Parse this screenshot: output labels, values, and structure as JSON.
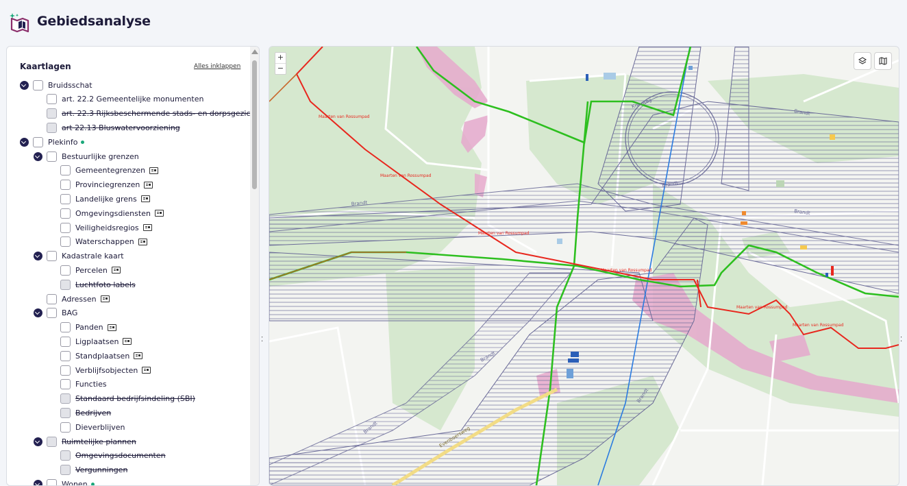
{
  "app": {
    "title": "Gebiedsanalyse"
  },
  "panel": {
    "title": "Kaartlagen",
    "collapse_all": "Alles inklappen",
    "rows": [
      {
        "label": "Bruidsschat",
        "level": 0,
        "toggle": true,
        "disabled": false,
        "strike": false,
        "info": false,
        "dot": false
      },
      {
        "label": "art. 22.2 Gemeentelijke monumenten",
        "level": 1,
        "toggle": false,
        "disabled": false,
        "strike": false,
        "info": false,
        "dot": false
      },
      {
        "label": "art. 22.3 Rijksbeschermende stads- en dorpsgezichten",
        "level": 1,
        "toggle": false,
        "disabled": true,
        "strike": true,
        "info": false,
        "dot": false
      },
      {
        "label": "art 22.13 Bluswatervoorziening",
        "level": 1,
        "toggle": false,
        "disabled": true,
        "strike": true,
        "info": false,
        "dot": false
      },
      {
        "label": "Plekinfo",
        "level": 0,
        "toggle": true,
        "disabled": false,
        "strike": false,
        "info": false,
        "dot": true
      },
      {
        "label": "Bestuurlijke grenzen",
        "level": 1,
        "toggle": true,
        "disabled": false,
        "strike": false,
        "info": false,
        "dot": false
      },
      {
        "label": "Gemeentegrenzen",
        "level": 2,
        "toggle": false,
        "disabled": false,
        "strike": false,
        "info": true,
        "dot": false
      },
      {
        "label": "Provinciegrenzen",
        "level": 2,
        "toggle": false,
        "disabled": false,
        "strike": false,
        "info": true,
        "dot": false
      },
      {
        "label": "Landelijke grens",
        "level": 2,
        "toggle": false,
        "disabled": false,
        "strike": false,
        "info": true,
        "dot": false
      },
      {
        "label": "Omgevingsdiensten",
        "level": 2,
        "toggle": false,
        "disabled": false,
        "strike": false,
        "info": true,
        "dot": false
      },
      {
        "label": "Veiligheidsregios",
        "level": 2,
        "toggle": false,
        "disabled": false,
        "strike": false,
        "info": true,
        "dot": false
      },
      {
        "label": "Waterschappen",
        "level": 2,
        "toggle": false,
        "disabled": false,
        "strike": false,
        "info": true,
        "dot": false
      },
      {
        "label": "Kadastrale kaart",
        "level": 1,
        "toggle": true,
        "disabled": false,
        "strike": false,
        "info": false,
        "dot": false
      },
      {
        "label": "Percelen",
        "level": 2,
        "toggle": false,
        "disabled": false,
        "strike": false,
        "info": true,
        "dot": false
      },
      {
        "label": "Luchtfoto labels",
        "level": 2,
        "toggle": false,
        "disabled": true,
        "strike": true,
        "info": false,
        "dot": false
      },
      {
        "label": "Adressen",
        "level": 1,
        "toggle": false,
        "disabled": false,
        "strike": false,
        "info": true,
        "dot": false
      },
      {
        "label": "BAG",
        "level": 1,
        "toggle": true,
        "disabled": false,
        "strike": false,
        "info": false,
        "dot": false
      },
      {
        "label": "Panden",
        "level": 2,
        "toggle": false,
        "disabled": false,
        "strike": false,
        "info": true,
        "dot": false
      },
      {
        "label": "Ligplaatsen",
        "level": 2,
        "toggle": false,
        "disabled": false,
        "strike": false,
        "info": true,
        "dot": false
      },
      {
        "label": "Standplaatsen",
        "level": 2,
        "toggle": false,
        "disabled": false,
        "strike": false,
        "info": true,
        "dot": false
      },
      {
        "label": "Verblijfsobjecten",
        "level": 2,
        "toggle": false,
        "disabled": false,
        "strike": false,
        "info": true,
        "dot": false
      },
      {
        "label": "Functies",
        "level": 2,
        "toggle": false,
        "disabled": false,
        "strike": false,
        "info": false,
        "dot": false
      },
      {
        "label": "Standaard bedrijfsindeling (SBI)",
        "level": 2,
        "toggle": false,
        "disabled": true,
        "strike": true,
        "info": false,
        "dot": false
      },
      {
        "label": "Bedrijven",
        "level": 2,
        "toggle": false,
        "disabled": true,
        "strike": true,
        "info": false,
        "dot": false
      },
      {
        "label": "Dieverblijven",
        "level": 2,
        "toggle": false,
        "disabled": false,
        "strike": false,
        "info": false,
        "dot": false
      },
      {
        "label": "Ruimtelijke plannen",
        "level": 1,
        "toggle": true,
        "disabled": true,
        "strike": true,
        "info": false,
        "dot": false
      },
      {
        "label": "Omgevingsdocumenten",
        "level": 2,
        "toggle": false,
        "disabled": true,
        "strike": true,
        "info": false,
        "dot": false
      },
      {
        "label": "Vergunningen",
        "level": 2,
        "toggle": false,
        "disabled": true,
        "strike": true,
        "info": false,
        "dot": false
      },
      {
        "label": "Wonen",
        "level": 1,
        "toggle": true,
        "disabled": false,
        "strike": false,
        "info": false,
        "dot": true
      }
    ]
  },
  "map": {
    "zoom_in": "+",
    "zoom_out": "−",
    "labels": {
      "road_red": "Maarten van Rossumpad",
      "road_green": "Kreuweg",
      "road_yellow": "Evenboersweg",
      "pipeline": "Brandt"
    },
    "colors": {
      "road_red": "#e8271e",
      "road_green": "#2dbf1f",
      "boundary_blue": "#2a7be0",
      "hatch": "#6a6a98",
      "woodland": "#d6e8cf",
      "pink_zone": "#e6a9cd"
    }
  }
}
